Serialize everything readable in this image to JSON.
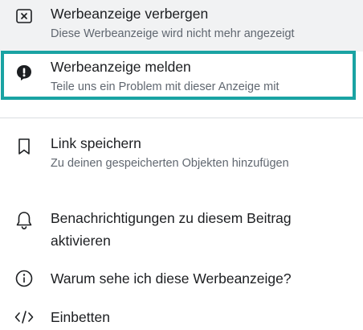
{
  "menu": {
    "items": [
      {
        "icon": "hide-ad-icon",
        "title": "Werbeanzeige verbergen",
        "subtitle": "Diese Werbeanzeige wird nicht mehr angezeigt"
      },
      {
        "icon": "report-ad-icon",
        "title": "Werbeanzeige melden",
        "subtitle": "Teile uns ein Problem mit dieser Anzeige mit"
      },
      {
        "icon": "bookmark-icon",
        "title": "Link speichern",
        "subtitle": "Zu deinen gespeicherten Objekten hinzufügen"
      },
      {
        "icon": "bell-icon",
        "title": "Benachrichtigungen zu diesem Beitrag",
        "title_line2": "aktivieren"
      },
      {
        "icon": "info-icon",
        "title": "Warum sehe ich diese Werbeanzeige?"
      },
      {
        "icon": "embed-icon",
        "title": "Einbetten"
      }
    ]
  },
  "colors": {
    "highlight_border": "#1aa3a3",
    "primary_text": "#1c1e21",
    "secondary_text": "#606770",
    "top_band": "#f1f2f3"
  }
}
